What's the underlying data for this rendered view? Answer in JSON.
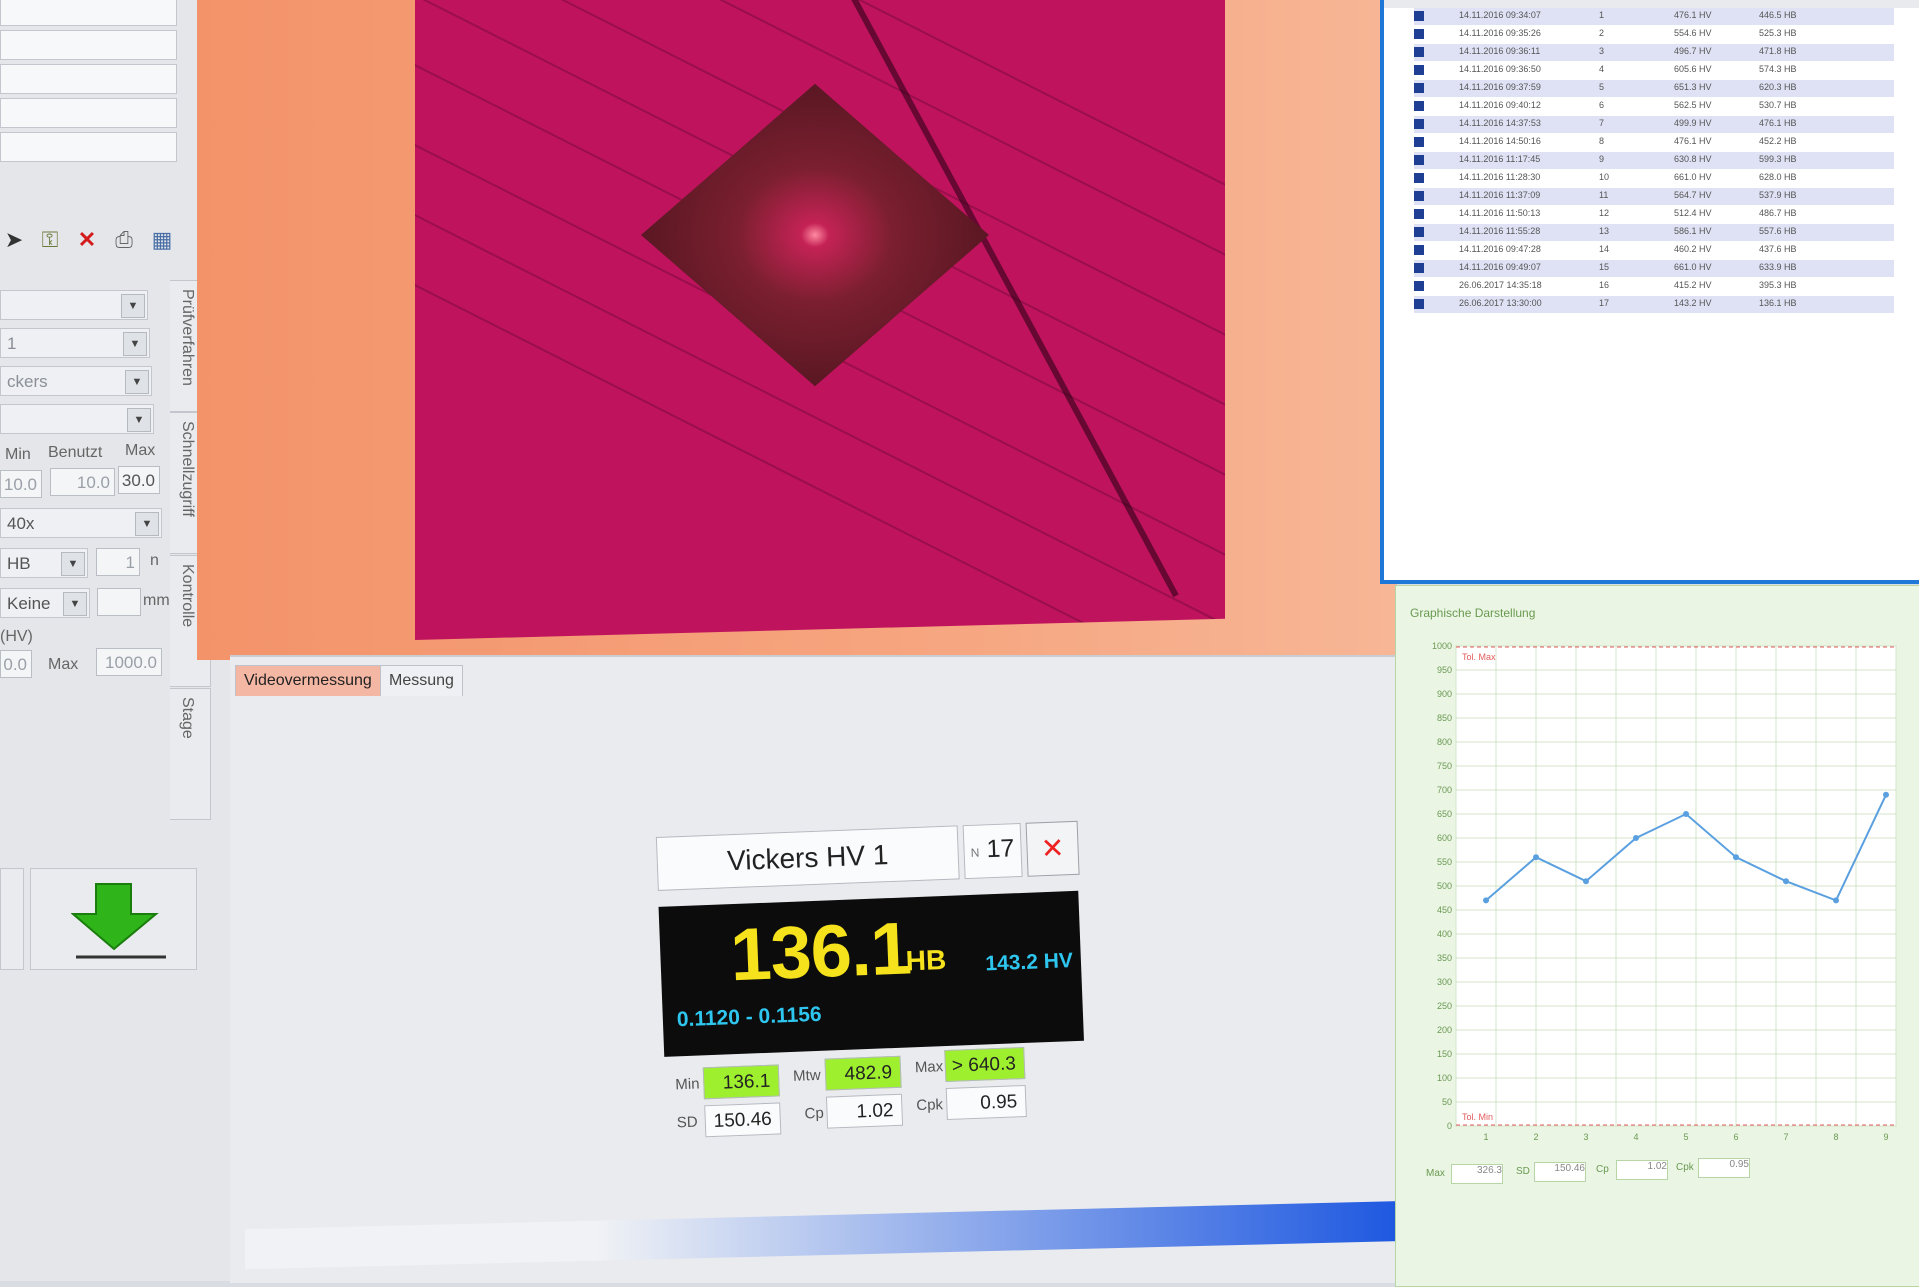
{
  "left_panel": {
    "combo1": "",
    "combo2": "1",
    "combo3": "ckers",
    "combo4": "",
    "col_min": "Min",
    "col_benutzt": "Benutzt",
    "col_max": "Max",
    "val_min": "10.0",
    "val_benutzt": "10.0",
    "val_max": "30.0",
    "objective": "40x",
    "hb_combo": "HB",
    "n_value": "1",
    "n_label": "n",
    "keine_combo": "Keine",
    "mm_label": "mm",
    "hv_label": "(HV)",
    "lim_min": "0.0",
    "lim_max_label": "Max",
    "lim_max": "1000.0",
    "vtabs": [
      "Prüfverfahren",
      "Schnellzugriff",
      "Kontrolle",
      "Stage"
    ],
    "icons": [
      "arrow-icon",
      "key-icon",
      "delete-icon",
      "print-icon",
      "table-icon"
    ]
  },
  "tabs": {
    "video": "Videovermessung",
    "messung": "Messung"
  },
  "measurement": {
    "name": "Vickers HV 1",
    "n_label": "N",
    "n_value": "17",
    "close": "✕",
    "big_value": "136.1",
    "big_unit": "HB",
    "hv_value": "143.2 HV",
    "range": "0.1120 - 0.1156",
    "stats": {
      "min_label": "Min",
      "min": "136.1",
      "mtw_label": "Mtw",
      "mtw": "482.9",
      "max_label": "Max",
      "max": "> 640.3",
      "sd_label": "SD",
      "sd": "150.46",
      "cp_label": "Cp",
      "cp": "1.02",
      "cpk_label": "Cpk",
      "cpk": "0.95"
    }
  },
  "table": {
    "rows": [
      {
        "c1": "14.11.2016 09:34:07",
        "c2": "1",
        "c3": "476.1 HV",
        "c4": "446.5 HB"
      },
      {
        "c1": "14.11.2016 09:35:26",
        "c2": "2",
        "c3": "554.6 HV",
        "c4": "525.3 HB"
      },
      {
        "c1": "14.11.2016 09:36:11",
        "c2": "3",
        "c3": "496.7 HV",
        "c4": "471.8 HB"
      },
      {
        "c1": "14.11.2016 09:36:50",
        "c2": "4",
        "c3": "605.6 HV",
        "c4": "574.3 HB"
      },
      {
        "c1": "14.11.2016 09:37:59",
        "c2": "5",
        "c3": "651.3 HV",
        "c4": "620.3 HB"
      },
      {
        "c1": "14.11.2016 09:40:12",
        "c2": "6",
        "c3": "562.5 HV",
        "c4": "530.7 HB"
      },
      {
        "c1": "14.11.2016 14:37:53",
        "c2": "7",
        "c3": "499.9 HV",
        "c4": "476.1 HB"
      },
      {
        "c1": "14.11.2016 14:50:16",
        "c2": "8",
        "c3": "476.1 HV",
        "c4": "452.2 HB"
      },
      {
        "c1": "14.11.2016 11:17:45",
        "c2": "9",
        "c3": "630.8 HV",
        "c4": "599.3 HB"
      },
      {
        "c1": "14.11.2016 11:28:30",
        "c2": "10",
        "c3": "661.0 HV",
        "c4": "628.0 HB"
      },
      {
        "c1": "14.11.2016 11:37:09",
        "c2": "11",
        "c3": "564.7 HV",
        "c4": "537.9 HB"
      },
      {
        "c1": "14.11.2016 11:50:13",
        "c2": "12",
        "c3": "512.4 HV",
        "c4": "486.7 HB"
      },
      {
        "c1": "14.11.2016 11:55:28",
        "c2": "13",
        "c3": "586.1 HV",
        "c4": "557.6 HB"
      },
      {
        "c1": "14.11.2016 09:47:28",
        "c2": "14",
        "c3": "460.2 HV",
        "c4": "437.6 HB"
      },
      {
        "c1": "14.11.2016 09:49:07",
        "c2": "15",
        "c3": "661.0 HV",
        "c4": "633.9 HB"
      },
      {
        "c1": "26.06.2017 14:35:18",
        "c2": "16",
        "c3": "415.2 HV",
        "c4": "395.3 HB"
      },
      {
        "c1": "26.06.2017 13:30:00",
        "c2": "17",
        "c3": "143.2 HV",
        "c4": "136.1 HB"
      }
    ]
  },
  "chart_panel": {
    "title": "Graphische Darstellung",
    "upper_limit_label": "Tol. Max",
    "lower_limit_label": "Tol. Min",
    "bottom_stats": {
      "max_label": "Max",
      "max": "326.3",
      "sd_label": "SD",
      "sd": "150.46",
      "cp_label": "Cp",
      "cp": "1.02",
      "cpk_label": "Cpk",
      "cpk": "0.95"
    }
  },
  "chart_data": {
    "type": "line",
    "title": "Graphische Darstellung",
    "ylim": [
      0,
      1000
    ],
    "y_ticks": [
      0,
      50,
      100,
      150,
      200,
      250,
      300,
      350,
      400,
      450,
      500,
      550,
      600,
      650,
      700,
      750,
      800,
      850,
      900,
      950,
      1000
    ],
    "x": [
      1,
      2,
      3,
      4,
      5,
      6,
      7,
      8,
      9
    ],
    "series": [
      {
        "values": [
          470,
          560,
          510,
          600,
          650,
          560,
          510,
          470,
          690
        ]
      }
    ],
    "color": "#5aa0e0",
    "grid": true
  }
}
